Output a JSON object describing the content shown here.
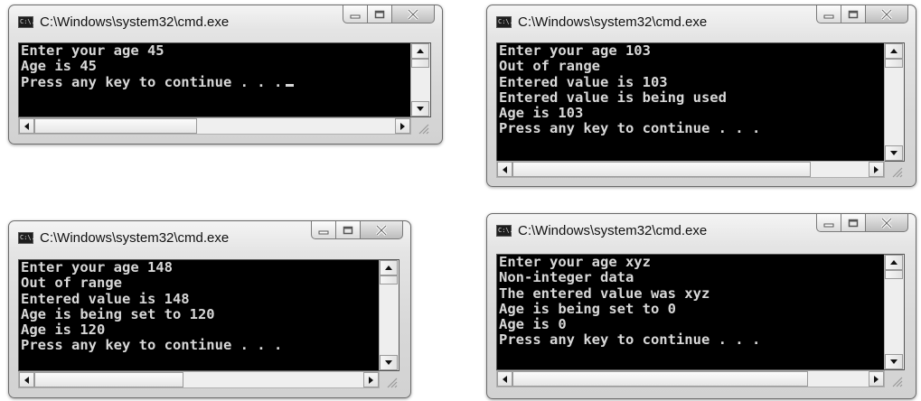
{
  "windows": [
    {
      "title": "C:\\Windows\\system32\\cmd.exe",
      "icon": "console-icon",
      "lines": [
        "Enter your age 45",
        "Age is 45",
        "Press any key to continue . . ."
      ]
    },
    {
      "title": "C:\\Windows\\system32\\cmd.exe",
      "icon": "console-icon",
      "lines": [
        "Enter your age 103",
        "Out of range",
        "Entered value is 103",
        "Entered value is being used",
        "Age is 103",
        "Press any key to continue . . ."
      ]
    },
    {
      "title": "C:\\Windows\\system32\\cmd.exe",
      "icon": "console-icon",
      "lines": [
        "Enter your age 148",
        "Out of range",
        "Entered value is 148",
        "Age is being set to 120",
        "Age is 120",
        "Press any key to continue . . ."
      ]
    },
    {
      "title": "C:\\Windows\\system32\\cmd.exe",
      "icon": "console-icon",
      "lines": [
        "Enter your age xyz",
        "Non-integer data",
        "The entered value was xyz",
        "Age is being set to 0",
        "Age is 0",
        "Press any key to continue . . ."
      ]
    }
  ],
  "icon_label": "C:\\.",
  "colors": {
    "console_bg": "#000000",
    "console_text": "#d8d8d8",
    "close_button": "#c9c9c9"
  }
}
